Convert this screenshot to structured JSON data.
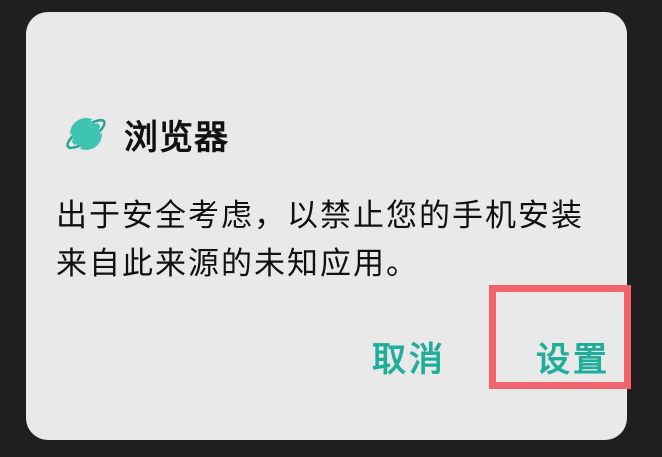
{
  "dialog": {
    "title": "浏览器",
    "app_icon": "planet-icon",
    "message_line1": "出于安全考虑，以禁止您的手机安装",
    "message_line2": "来自此来源的未知应用。",
    "cancel_label": "取消",
    "settings_label": "设置"
  },
  "colors": {
    "accent": "#1fae9a",
    "icon": "#3fc3b3",
    "dialog_bg": "#e9e9e9",
    "backdrop": "#1f1f1f",
    "highlight_border": "#f2636e"
  }
}
